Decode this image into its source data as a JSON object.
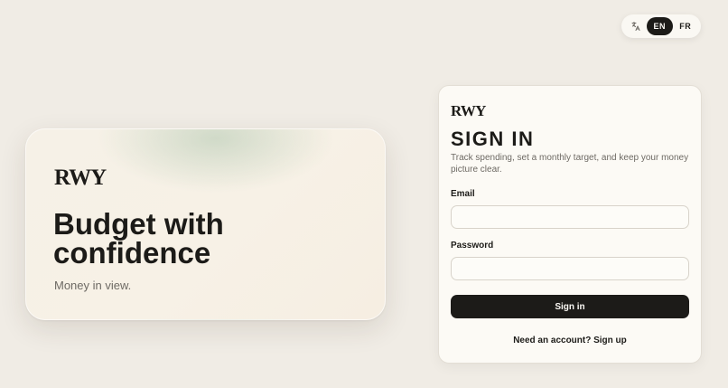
{
  "language_switcher": {
    "icon": "translate-icon",
    "active": "EN",
    "options": [
      "EN",
      "FR"
    ]
  },
  "hero": {
    "logo": "RWY",
    "title": "Budget with confidence",
    "subtitle": "Money in view."
  },
  "signin": {
    "logo": "RWY",
    "title": "SIGN IN",
    "description": "Track spending, set a monthly target, and keep your money picture clear.",
    "email_label": "Email",
    "email_value": "",
    "password_label": "Password",
    "password_value": "",
    "submit_label": "Sign in",
    "signup_text": "Need an account? Sign up"
  },
  "colors": {
    "background": "#f0ece5",
    "primary": "#1c1b18",
    "card": "#fcfaf5",
    "muted_text": "#6e6a64"
  }
}
